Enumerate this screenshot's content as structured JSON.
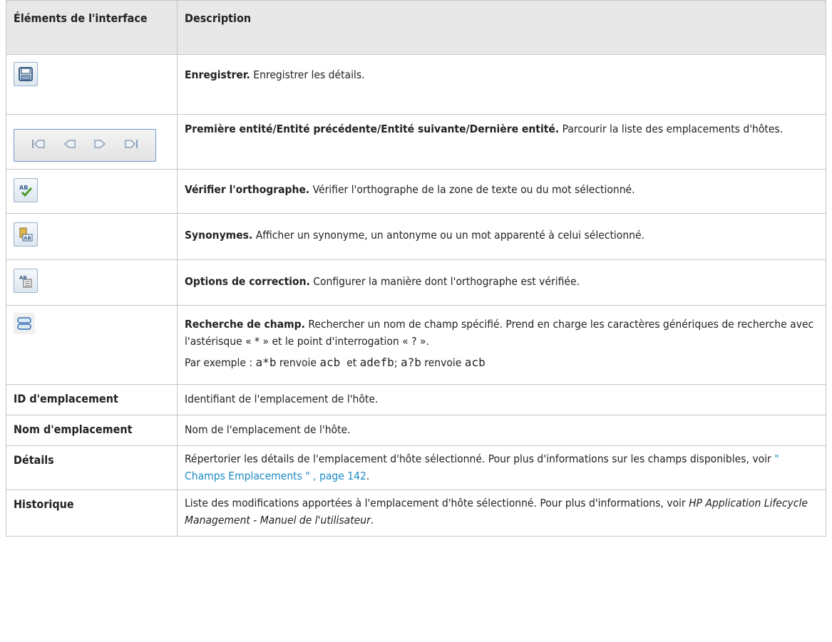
{
  "header": {
    "col1": "Éléments de l'interface",
    "col2": "Description"
  },
  "rows": [
    {
      "icon": "save-icon",
      "title": "Enregistrer.",
      "text": "Enregistrer les détails."
    },
    {
      "icon": "navigation-arrows-icon",
      "title": "Première entité/Entité précédente/Entité suivante/Dernière entité.",
      "text": "Parcourir la liste des emplacements d'hôtes."
    },
    {
      "icon": "spell-check-icon",
      "title": "Vérifier l'orthographe.",
      "text": "Vérifier l'orthographe de la zone de texte ou du mot sélectionné."
    },
    {
      "icon": "thesaurus-icon",
      "title": "Synonymes.",
      "text": "Afficher un synonyme, un antonyme ou un mot apparenté à celui sélectionné."
    },
    {
      "icon": "spelling-options-icon",
      "title": "Options de correction.",
      "text": "Configurer la manière dont l'orthographe est vérifiée."
    },
    {
      "icon": "field-search-icon",
      "title": "Recherche de champ.",
      "text": "Rechercher un nom de champ spécifié. Prend en charge les caractères génériques de recherche avec l'astérisque « * » et le point d'interrogation « ? ».",
      "example": {
        "prefix": "Par exemple :",
        "c1": "a*b",
        "w1": "renvoie",
        "c2": "acb",
        "w2": "et",
        "c3": "adefb",
        "sep": ";",
        "c4": "a?b",
        "w3": "renvoie",
        "c5": "acb"
      }
    },
    {
      "label": "ID d'emplacement",
      "text": "Identifiant de l'emplacement de l'hôte."
    },
    {
      "label": "Nom d'emplacement",
      "text": "Nom de l'emplacement de l'hôte."
    },
    {
      "label": "Détails",
      "text": "Répertorier les détails de l'emplacement d'hôte sélectionné. Pour plus d'informations sur les champs disponibles, voir",
      "link": "\" Champs Emplacements \" , page 142",
      "after": "."
    },
    {
      "label": "Historique",
      "text": "Liste des modifications apportées à l'emplacement d'hôte sélectionné. Pour plus d'informations, voir",
      "italic": "HP Application Lifecycle Management - Manuel de l'utilisateur",
      "after": "."
    }
  ]
}
